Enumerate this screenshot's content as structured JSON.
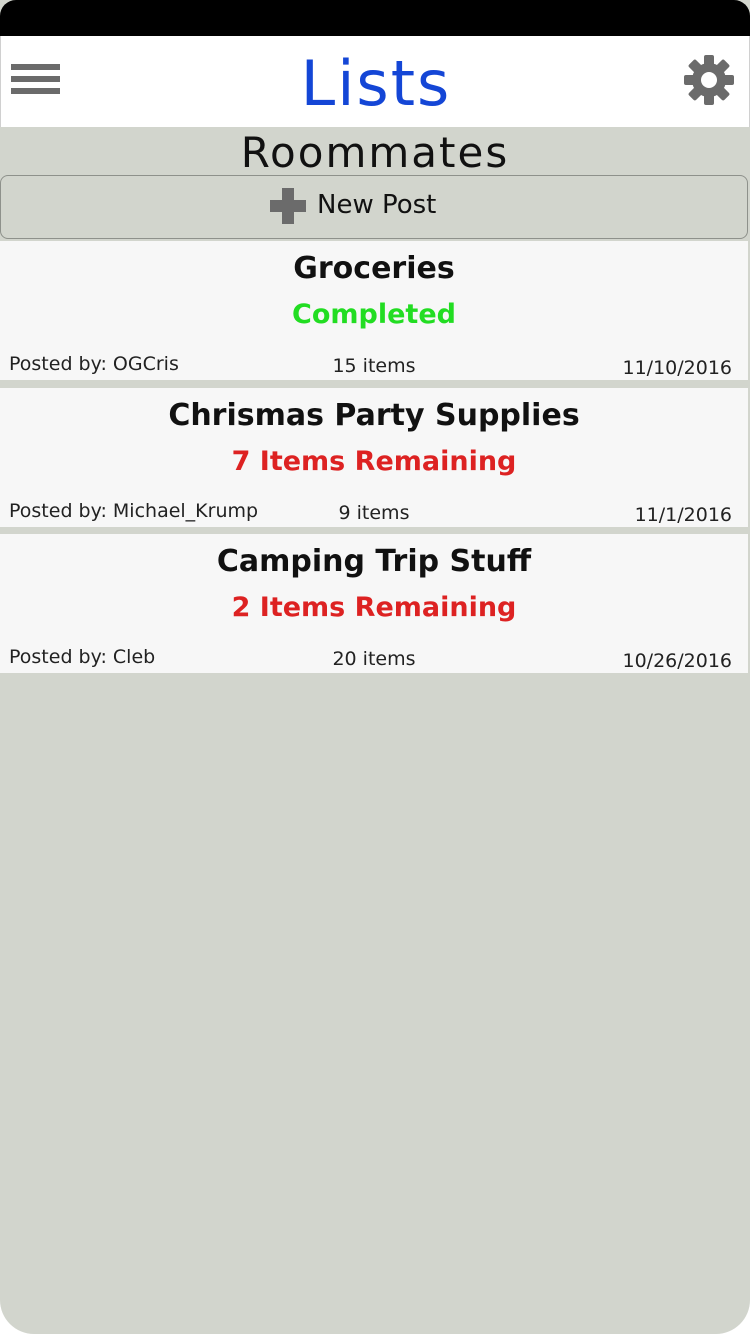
{
  "header": {
    "title": "Lists",
    "menu_icon": "hamburger-icon",
    "settings_icon": "gear-icon",
    "title_color": "#1446d6"
  },
  "group": {
    "name": "Roommates"
  },
  "new_post": {
    "label": "New Post",
    "icon": "plus-icon"
  },
  "lists": [
    {
      "title": "Groceries",
      "status": "Completed",
      "status_type": "completed",
      "poster": "Posted by: OGCris",
      "count": "15 items",
      "date": "11/10/2016"
    },
    {
      "title": "Chrismas Party Supplies",
      "status": "7 Items Remaining",
      "status_type": "pending",
      "poster": "Posted by: Michael_Krump",
      "count": "9 items",
      "date": "11/1/2016"
    },
    {
      "title": "Camping Trip Stuff",
      "status": "2 Items Remaining",
      "status_type": "pending",
      "poster": "Posted by: Cleb",
      "count": "20 items",
      "date": "10/26/2016"
    }
  ],
  "colors": {
    "completed": "#22dd22",
    "pending": "#dd2222",
    "background": "#d2d5cd"
  }
}
